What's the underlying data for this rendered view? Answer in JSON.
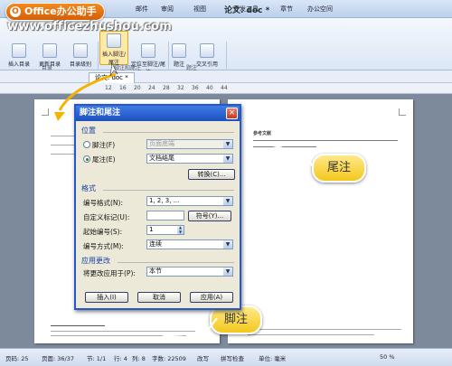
{
  "watermark": {
    "badge": "Office办公助手",
    "url": "www.officezhushou.com"
  },
  "title": "论文. doc *",
  "menu": [
    "邮件",
    "审阅",
    "视图",
    "开发工具",
    "章节",
    "办公空间"
  ],
  "ribbon": {
    "buttons": [
      "插入目录",
      "更新目录",
      "目录级别",
      "插入脚注/尾注",
      "定位至脚注/尾注",
      "题注",
      "交叉引用"
    ],
    "groups": [
      "目录",
      "脚注和尾注",
      "题注"
    ]
  },
  "doc_tab": "论文. doc *",
  "ruler": [
    "12",
    "16",
    "20",
    "24",
    "28",
    "32",
    "36",
    "40",
    "44"
  ],
  "callouts": {
    "endnote": "尾注",
    "footnote": "脚注"
  },
  "dialog": {
    "title": "脚注和尾注",
    "close": "×",
    "position_label": "位置",
    "footnote_option": "脚注(F)",
    "footnote_select": "页面底端",
    "endnote_option": "尾注(E)",
    "endnote_select": "文档结尾",
    "convert_button": "转换(C)...",
    "format_label": "格式",
    "number_format_label": "编号格式(N):",
    "number_format_value": "1, 2, 3, ...",
    "custom_mark_label": "自定义标记(U):",
    "custom_mark_value": "",
    "symbol_button": "符号(Y)...",
    "start_at_label": "起始编号(S):",
    "start_at_value": "1",
    "numbering_label": "编号方式(M):",
    "numbering_value": "连续",
    "apply_label": "应用更改",
    "apply_to_label": "将更改应用于(P):",
    "apply_to_value": "本节",
    "insert_button": "插入(I)",
    "cancel_button": "取消",
    "apply_button": "应用(A)"
  },
  "right_page": {
    "heading": "参考文献"
  },
  "statusbar": [
    "页码: 25",
    "页面: 36/37",
    "节: 1/1",
    "行: 4",
    "列: 8",
    "字数: 22509",
    "改写",
    "拼写检查",
    "单位: 毫米"
  ],
  "zoom": "50 %"
}
